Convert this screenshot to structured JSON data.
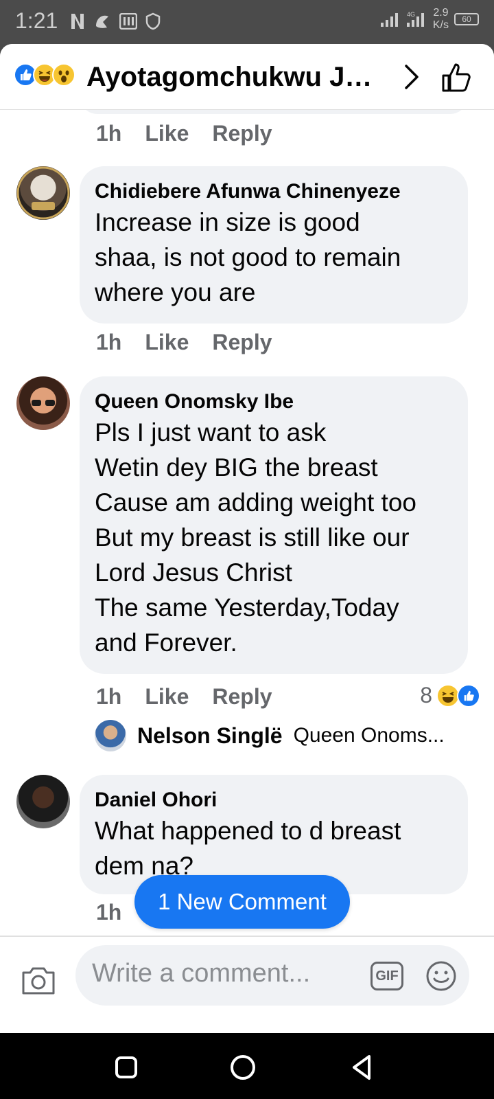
{
  "status_bar": {
    "time": "1:21",
    "speed_value": "2.9",
    "speed_unit": "K/s",
    "battery": "60",
    "network": "4G"
  },
  "header": {
    "title": "Ayotagomchukwu Jo...",
    "reactions": [
      "like",
      "haha",
      "wow"
    ]
  },
  "comments": [
    {
      "author": "Chidiebere Afunwa Chinenyeze",
      "text": "Increase in size is good\nshaa, is not good to remain\nwhere you are",
      "time": "1h",
      "like_label": "Like",
      "reply_label": "Reply"
    },
    {
      "author": "Queen Onomsky Ibe",
      "text": "Pls I just want to ask\nWetin dey BIG the breast\nCause am adding weight too\nBut my breast is still like our\nLord Jesus Christ\nThe same Yesterday,Today\nand Forever.",
      "time": "1h",
      "like_label": "Like",
      "reply_label": "Reply",
      "reaction_count": "8",
      "reply_preview": {
        "author": "Nelson Singlë",
        "text": "Queen Onoms..."
      }
    },
    {
      "author": "Daniel Ohori",
      "text": "What happened to d breast\ndem na?",
      "time": "1h"
    }
  ],
  "previous_comment_meta": {
    "time": "1h",
    "like_label": "Like",
    "reply_label": "Reply"
  },
  "new_comment_pill": "1 New Comment",
  "composer": {
    "placeholder": "Write a comment...",
    "gif_label": "GIF"
  }
}
